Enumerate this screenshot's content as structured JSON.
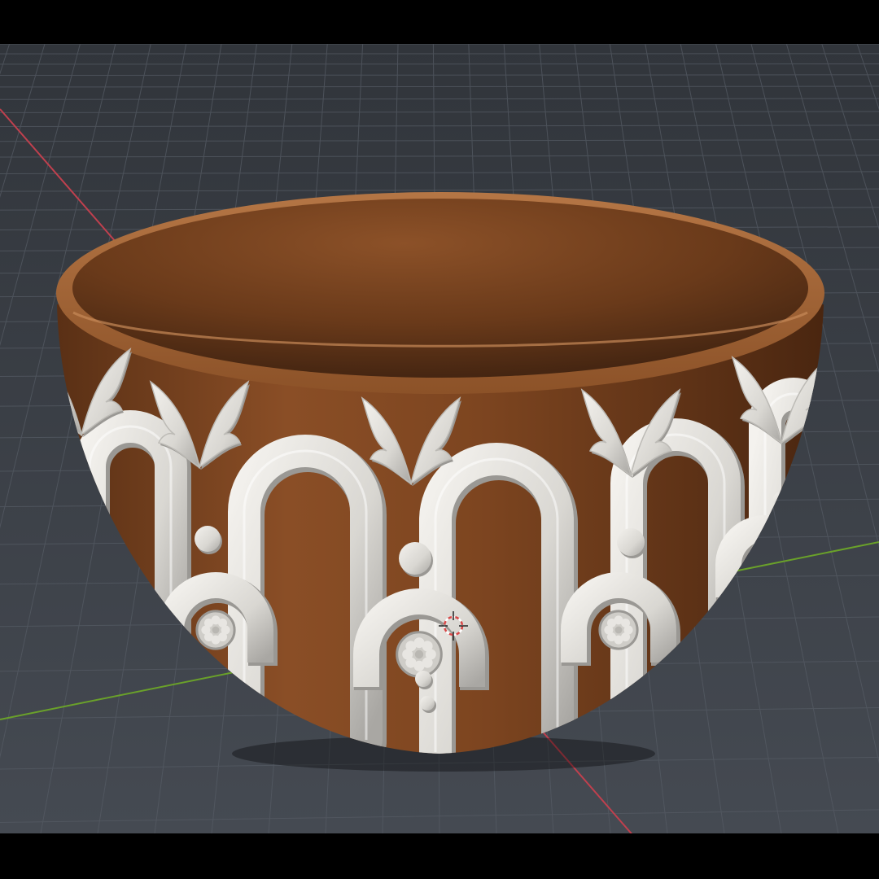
{
  "viewport": {
    "background": "#3b3f46",
    "grid_color": "#4c525b",
    "x_axis_color": "#c0404e",
    "y_axis_color": "#6aa12a"
  },
  "model": {
    "body_color": "#7a4420",
    "rim_color": "#a86a3e",
    "ornament_color": "#e8e6e2",
    "ornament_shadow": "#9a9894"
  },
  "cursor": {
    "icon": "3d-cursor-icon",
    "ring_color": "#d94848"
  }
}
